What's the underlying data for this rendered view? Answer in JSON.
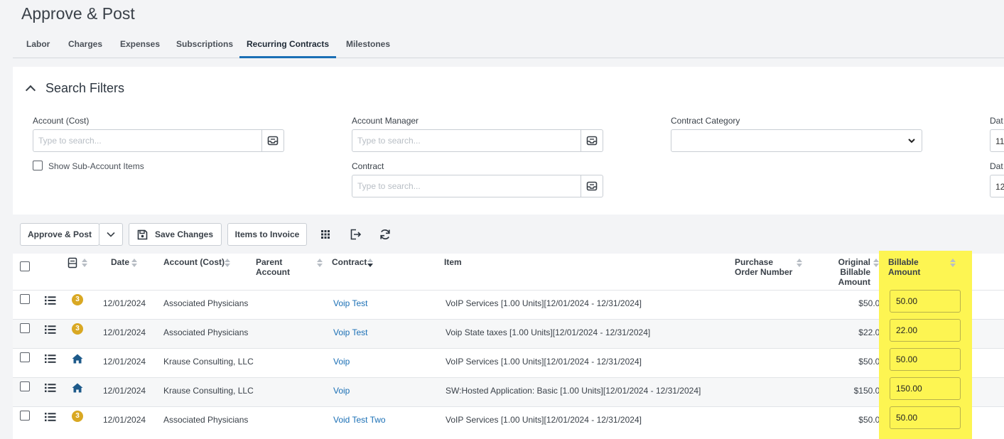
{
  "page": {
    "title": "Approve & Post"
  },
  "tabs": [
    {
      "label": "Labor"
    },
    {
      "label": "Charges"
    },
    {
      "label": "Expenses"
    },
    {
      "label": "Subscriptions"
    },
    {
      "label": "Recurring Contracts",
      "active": true
    },
    {
      "label": "Milestones"
    }
  ],
  "filters": {
    "title": "Search Filters",
    "account_cost": {
      "label": "Account (Cost)",
      "placeholder": "Type to search..."
    },
    "show_sub_accounts": {
      "label": "Show Sub-Account Items",
      "checked": false
    },
    "account_manager": {
      "label": "Account Manager",
      "placeholder": "Type to search..."
    },
    "contract": {
      "label": "Contract",
      "placeholder": "Type to search..."
    },
    "contract_category": {
      "label": "Contract Category",
      "value": ""
    },
    "date_from": {
      "label": "Dat",
      "value": "11"
    },
    "date_to": {
      "label": "Dat",
      "value": "12"
    }
  },
  "toolbar": {
    "approve_post": "Approve & Post",
    "save_changes": "Save Changes",
    "items_to_invoice": "Items to Invoice"
  },
  "columns": {
    "date": "Date",
    "account_cost": "Account (Cost)",
    "parent_account": "Parent Account",
    "contract": "Contract",
    "item": "Item",
    "po_number": "Purchase Order Number",
    "original_billable": "Original Billable Amount",
    "billable_amount": "Billable Amount"
  },
  "rows": [
    {
      "type_icon": "badge-3-icon",
      "badge": "3",
      "date": "12/01/2024",
      "account": "Associated Physicians",
      "parent_account": "",
      "contract": "Voip Test",
      "item": "VoIP Services [1.00 Units][12/01/2024 - 12/31/2024]",
      "po_number": "",
      "original": "$50.00",
      "billable": "50.00"
    },
    {
      "type_icon": "badge-3-icon",
      "badge": "3",
      "date": "12/01/2024",
      "account": "Associated Physicians",
      "parent_account": "",
      "contract": "Voip Test",
      "item": "Voip State taxes [1.00 Units][12/01/2024 - 12/31/2024]",
      "po_number": "",
      "original": "$22.00",
      "billable": "22.00"
    },
    {
      "type_icon": "home-icon",
      "badge": "",
      "date": "12/01/2024",
      "account": "Krause Consulting, LLC",
      "parent_account": "",
      "contract": "Voip",
      "item": "VoIP Services [1.00 Units][12/01/2024 - 12/31/2024]",
      "po_number": "",
      "original": "$50.00",
      "billable": "50.00"
    },
    {
      "type_icon": "home-icon",
      "badge": "",
      "date": "12/01/2024",
      "account": "Krause Consulting, LLC",
      "parent_account": "",
      "contract": "Voip",
      "item": "SW:Hosted Application: Basic [1.00 Units][12/01/2024 - 12/31/2024]",
      "po_number": "",
      "original": "$150.00",
      "billable": "150.00"
    },
    {
      "type_icon": "badge-3-icon",
      "badge": "3",
      "date": "12/01/2024",
      "account": "Associated Physicians",
      "parent_account": "",
      "contract": "Void Test Two",
      "item": "VoIP Services [1.00 Units][12/01/2024 - 12/31/2024]",
      "po_number": "",
      "original": "$50.00",
      "billable": "50.00"
    }
  ],
  "colors": {
    "accent": "#1a6fb5",
    "highlight": "#fdf552",
    "badge": "#d9a823",
    "home_icon": "#1d5a8a"
  }
}
